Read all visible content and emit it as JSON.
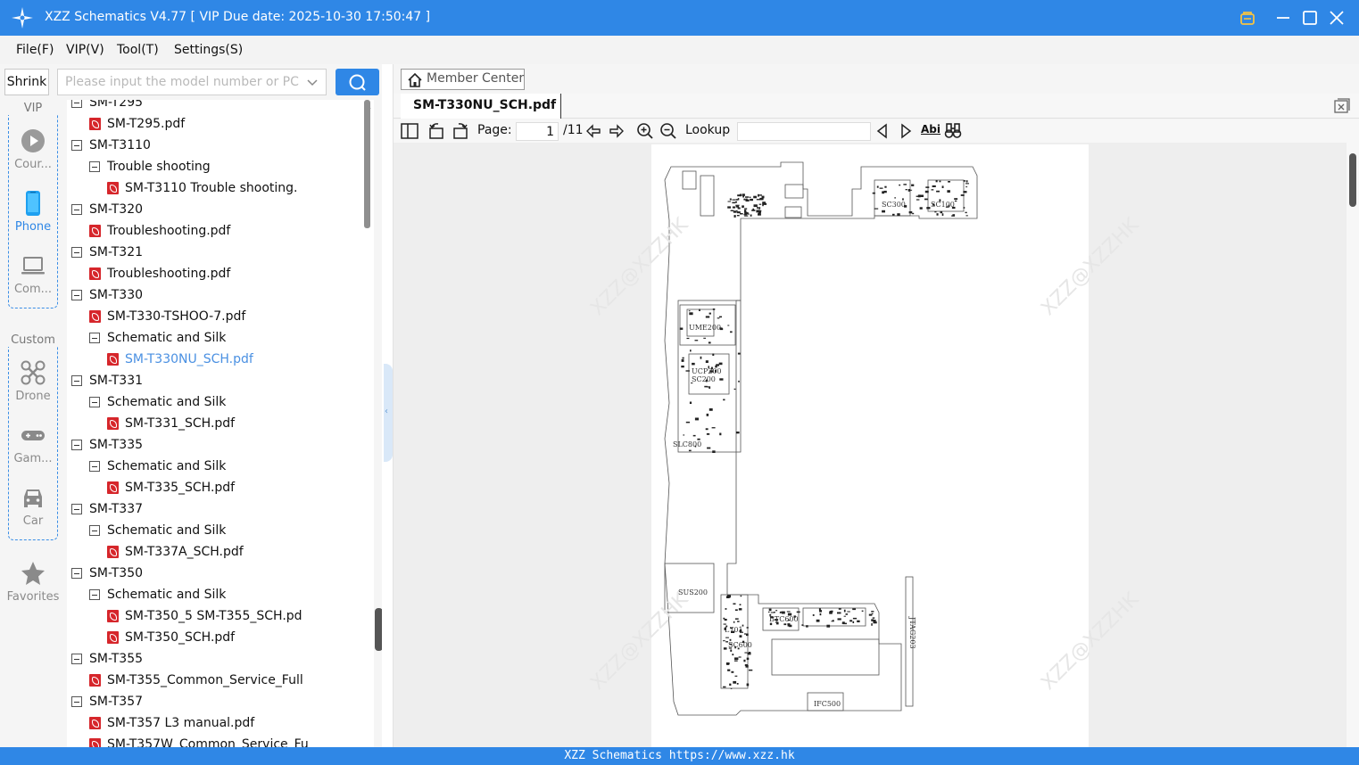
{
  "titlebar": {
    "title": "XZZ Schematics V4.77 [ VIP Due date: 2025-10-30 17:50:47 ]"
  },
  "menu": [
    "File(F)",
    "VIP(V)",
    "Tool(T)",
    "Settings(S)"
  ],
  "search": {
    "shrink_label": "Shrink",
    "placeholder": "Please input the model number or PCB"
  },
  "sidebar": {
    "vip_label": "VIP",
    "custom_label": "Custom",
    "categories": [
      {
        "label": "Cour...",
        "icon": "play-circle-icon",
        "active": false
      },
      {
        "label": "Phone",
        "icon": "phone-icon",
        "active": true
      },
      {
        "label": "Com...",
        "icon": "laptop-icon",
        "active": false
      },
      {
        "label": "Drone",
        "icon": "drone-icon",
        "active": false
      },
      {
        "label": "Gam...",
        "icon": "gamepad-icon",
        "active": false
      },
      {
        "label": "Car",
        "icon": "car-icon",
        "active": false
      },
      {
        "label": "Favorites",
        "icon": "star-icon",
        "active": false
      }
    ],
    "accent": "#2f87e6"
  },
  "tree": [
    {
      "level": 0,
      "type": "folder",
      "label": "SM-T295"
    },
    {
      "level": 1,
      "type": "pdf",
      "label": "SM-T295.pdf"
    },
    {
      "level": 0,
      "type": "folder",
      "label": "SM-T3110"
    },
    {
      "level": 1,
      "type": "folder",
      "label": "Trouble shooting"
    },
    {
      "level": 2,
      "type": "pdf",
      "label": "SM-T3110 Trouble shooting."
    },
    {
      "level": 0,
      "type": "folder",
      "label": "SM-T320"
    },
    {
      "level": 1,
      "type": "pdf",
      "label": "Troubleshooting.pdf"
    },
    {
      "level": 0,
      "type": "folder",
      "label": "SM-T321"
    },
    {
      "level": 1,
      "type": "pdf",
      "label": "Troubleshooting.pdf"
    },
    {
      "level": 0,
      "type": "folder",
      "label": "SM-T330"
    },
    {
      "level": 1,
      "type": "pdf",
      "label": "SM-T330-TSHOO-7.pdf"
    },
    {
      "level": 1,
      "type": "folder",
      "label": "Schematic and Silk"
    },
    {
      "level": 2,
      "type": "pdf",
      "label": "SM-T330NU_SCH.pdf",
      "selected": true
    },
    {
      "level": 0,
      "type": "folder",
      "label": "SM-T331"
    },
    {
      "level": 1,
      "type": "folder",
      "label": "Schematic and Silk"
    },
    {
      "level": 2,
      "type": "pdf",
      "label": "SM-T331_SCH.pdf"
    },
    {
      "level": 0,
      "type": "folder",
      "label": "SM-T335"
    },
    {
      "level": 1,
      "type": "folder",
      "label": "Schematic and Silk"
    },
    {
      "level": 2,
      "type": "pdf",
      "label": "SM-T335_SCH.pdf"
    },
    {
      "level": 0,
      "type": "folder",
      "label": "SM-T337"
    },
    {
      "level": 1,
      "type": "folder",
      "label": "Schematic and Silk"
    },
    {
      "level": 2,
      "type": "pdf",
      "label": "SM-T337A_SCH.pdf"
    },
    {
      "level": 0,
      "type": "folder",
      "label": "SM-T350"
    },
    {
      "level": 1,
      "type": "folder",
      "label": "Schematic and Silk"
    },
    {
      "level": 2,
      "type": "pdf",
      "label": "SM-T350_5 SM-T355_SCH.pd"
    },
    {
      "level": 2,
      "type": "pdf",
      "label": "SM-T350_SCH.pdf"
    },
    {
      "level": 0,
      "type": "folder",
      "label": "SM-T355"
    },
    {
      "level": 1,
      "type": "pdf",
      "label": "SM-T355_Common_Service_Full"
    },
    {
      "level": 0,
      "type": "folder",
      "label": "SM-T357"
    },
    {
      "level": 1,
      "type": "pdf",
      "label": "SM-T357 L3 manual.pdf"
    },
    {
      "level": 1,
      "type": "pdf",
      "label": "SM-T357W_Common_Service_Fu"
    }
  ],
  "viewer": {
    "member_center": "Member Center",
    "tab_title": "SM-T330NU_SCH.pdf",
    "page_label": "Page:",
    "page_current": "1",
    "page_total": "/11",
    "lookup_label": "Lookup",
    "lookup_value": "",
    "abi_label": "Abi",
    "watermark": "XZZ@XZZHK",
    "board_labels": [
      "UME200",
      "UCP200",
      "SC200",
      "SUS200",
      "BTC600",
      "L701",
      "SC600",
      "IFC500",
      "JTAG203",
      "SLC800",
      "SC300",
      "SC100"
    ]
  },
  "statusbar": {
    "text": "XZZ Schematics https://www.xzz.hk"
  }
}
